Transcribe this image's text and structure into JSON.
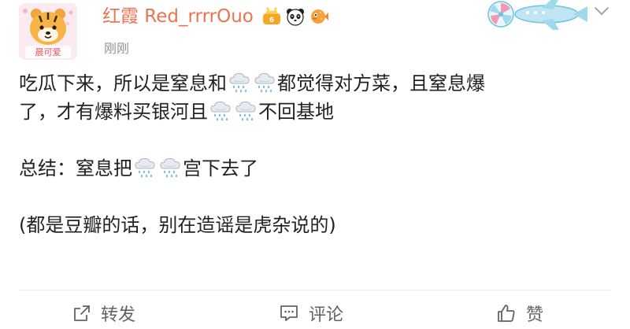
{
  "post": {
    "username": "红霞 Red_rrrrOuo",
    "timestamp": "刚刚",
    "avatar_caption": "晨可爱",
    "line1a": "吃瓜下来，所以是窒息和",
    "line1b": "都觉得对方菜，且窒息爆",
    "line2a": "了，才有爆料买银河且",
    "line2b": "不回基地",
    "summary_a": "总结：窒息把",
    "summary_b": "宫下去了",
    "note": "(都是豆瓣的话，别在造谣是虎杂说的)"
  },
  "icons": {
    "badges": [
      "crown-badge-icon",
      "panda-icon",
      "pufferfish-icon"
    ],
    "emoji": "rain-cloud-emoji",
    "decor": "airplane-fan-decoration"
  },
  "actions": {
    "repost_label": "转发",
    "comment_label": "评论",
    "like_label": "赞"
  },
  "colors": {
    "username": "#eb7350",
    "meta": "#939393",
    "text": "#222222",
    "action": "#636363"
  }
}
